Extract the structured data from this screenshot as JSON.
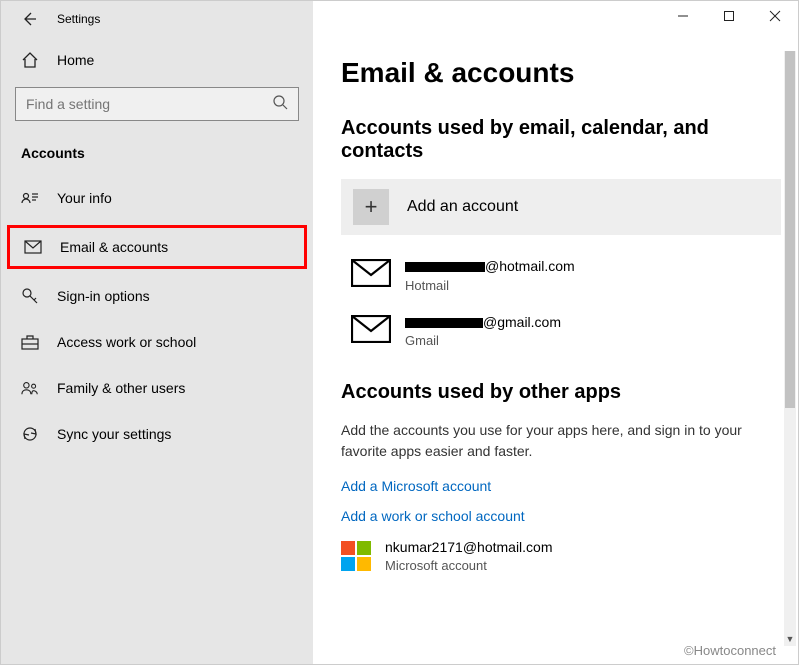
{
  "window": {
    "title": "Settings",
    "min_tooltip": "Minimize",
    "max_tooltip": "Maximize",
    "close_tooltip": "Close"
  },
  "sidebar": {
    "home_label": "Home",
    "search_placeholder": "Find a setting",
    "category": "Accounts",
    "items": [
      {
        "label": "Your info",
        "selected": false
      },
      {
        "label": "Email & accounts",
        "selected": true
      },
      {
        "label": "Sign-in options",
        "selected": false
      },
      {
        "label": "Access work or school",
        "selected": false
      },
      {
        "label": "Family & other users",
        "selected": false
      },
      {
        "label": "Sync your settings",
        "selected": false
      }
    ]
  },
  "main": {
    "page_title": "Email & accounts",
    "section1_title": "Accounts used by email, calendar, and contacts",
    "add_account_label": "Add an account",
    "accounts": [
      {
        "suffix": "@hotmail.com",
        "provider": "Hotmail"
      },
      {
        "suffix": "@gmail.com",
        "provider": "Gmail"
      }
    ],
    "section2_title": "Accounts used by other apps",
    "body_text": "Add the accounts you use for your apps here, and sign in to your favorite apps easier and faster.",
    "link_ms": "Add a Microsoft account",
    "link_work": "Add a work or school account",
    "ms_account": {
      "email": "nkumar2171@hotmail.com",
      "label": "Microsoft account"
    }
  },
  "watermark": "©Howtoconnect"
}
